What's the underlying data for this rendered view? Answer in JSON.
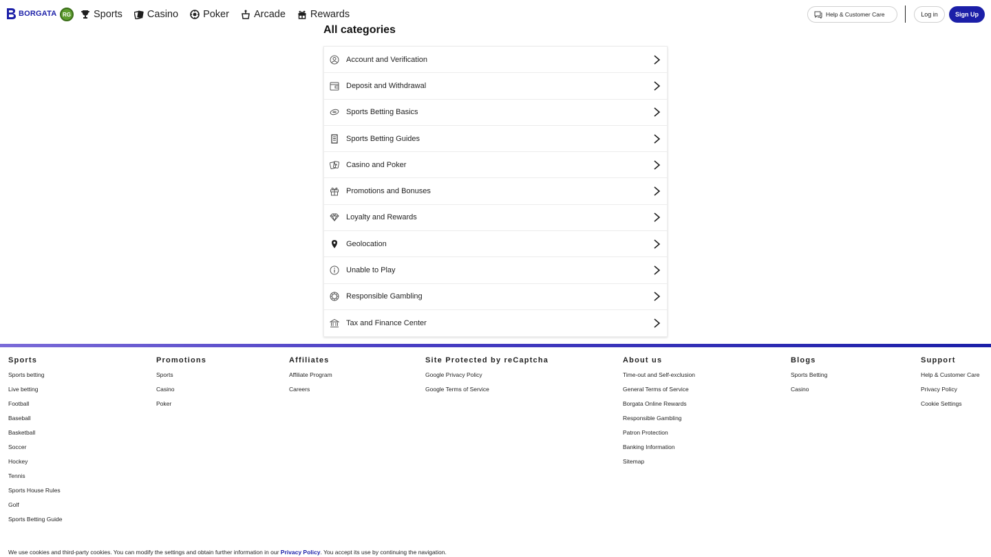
{
  "header": {
    "logo_text": "BORGATA",
    "rg_badge": "RG",
    "nav": [
      {
        "label": "Sports",
        "icon": "trophy-icon"
      },
      {
        "label": "Casino",
        "icon": "cards-icon"
      },
      {
        "label": "Poker",
        "icon": "poker-chip-icon"
      },
      {
        "label": "Arcade",
        "icon": "arcade-icon"
      },
      {
        "label": "Rewards",
        "icon": "gift-icon"
      }
    ],
    "help_label": "Help & Customer Care",
    "login_label": "Log in",
    "signup_label": "Sign Up",
    "brand_color": "#1b1fa8"
  },
  "categories": {
    "title": "All categories",
    "items": [
      {
        "label": "Account and Verification",
        "icon": "user-circle-icon"
      },
      {
        "label": "Deposit and Withdrawal",
        "icon": "wallet-icon"
      },
      {
        "label": "Sports Betting Basics",
        "icon": "football-icon"
      },
      {
        "label": "Sports Betting Guides",
        "icon": "document-icon"
      },
      {
        "label": "Casino and Poker",
        "icon": "cards-icon"
      },
      {
        "label": "Promotions and Bonuses",
        "icon": "gift-icon"
      },
      {
        "label": "Loyalty and Rewards",
        "icon": "diamond-icon"
      },
      {
        "label": "Geolocation",
        "icon": "map-pin-icon"
      },
      {
        "label": "Unable to Play",
        "icon": "info-icon"
      },
      {
        "label": "Responsible Gambling",
        "icon": "chip-icon"
      },
      {
        "label": "Tax and Finance Center",
        "icon": "bank-icon"
      }
    ]
  },
  "footer": {
    "columns": [
      {
        "heading": "Sports",
        "links": [
          "Sports betting",
          "Live betting",
          "Football",
          "Baseball",
          "Basketball",
          "Soccer",
          "Hockey",
          "Tennis",
          "Sports House Rules",
          "Golf",
          "Sports Betting Guide"
        ]
      },
      {
        "heading": "Promotions",
        "links": [
          "Sports",
          "Casino",
          "Poker"
        ]
      },
      {
        "heading": "Affiliates",
        "links": [
          "Affiliate Program",
          "Careers"
        ]
      },
      {
        "heading": "Site Protected by reCaptcha",
        "links": [
          "Google Privacy Policy",
          "Google Terms of Service"
        ]
      },
      {
        "heading": "About us",
        "links": [
          "Time-out and Self-exclusion",
          "General Terms of Service",
          "Borgata Online Rewards",
          "Responsible Gambling",
          "Patron Protection",
          "Banking Information",
          "Sitemap"
        ]
      },
      {
        "heading": "Blogs",
        "links": [
          "Sports Betting",
          "Casino"
        ]
      },
      {
        "heading": "Support",
        "links": [
          "Help & Customer Care",
          "Privacy Policy",
          "Cookie Settings"
        ]
      }
    ]
  },
  "cookie_notice": {
    "before": "We use cookies and third-party cookies. You can modify the settings and obtain further information in our ",
    "link": "Privacy Policy",
    "after": ". You accept its use by continuing the navigation."
  }
}
